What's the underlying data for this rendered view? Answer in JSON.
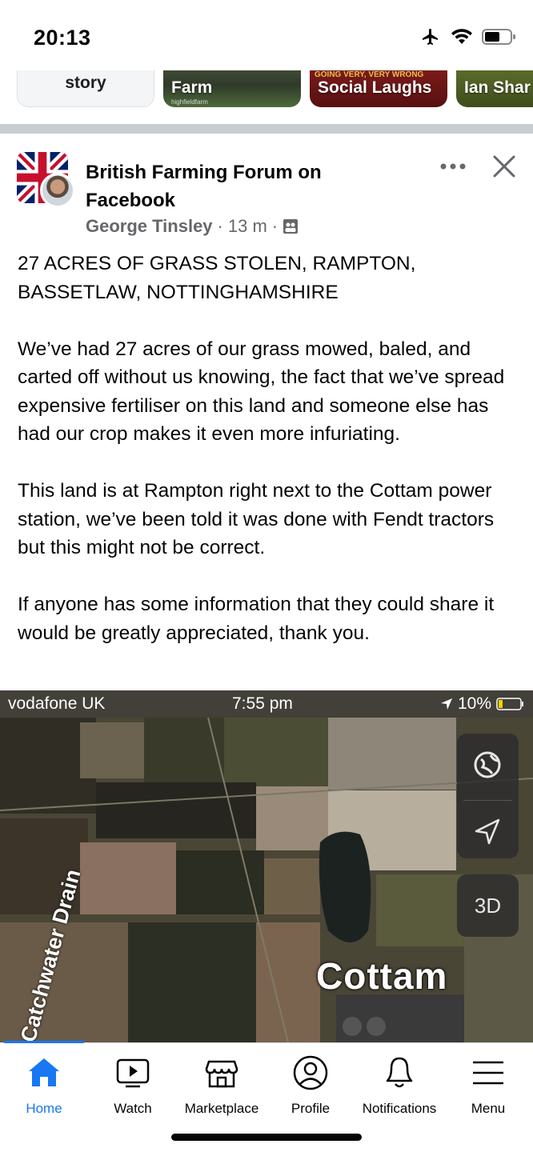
{
  "status_bar": {
    "time": "20:13",
    "icons": [
      "airplane-icon",
      "wifi-icon",
      "battery-icon"
    ]
  },
  "stories": [
    {
      "label": "story",
      "type": "create"
    },
    {
      "label": "Farm",
      "handle": "highfieldfarm"
    },
    {
      "label": "Social Laughs",
      "overlay": "GOING VERY, VERY WRONG"
    },
    {
      "label": "Ian Shar"
    }
  ],
  "post": {
    "group_name": "British Farming Forum on Facebook",
    "author": "George Tinsley",
    "time": "13 m",
    "separator": "·",
    "paragraphs": [
      "27 ACRES OF GRASS STOLEN, RAMPTON, BASSETLAW, NOTTINGHAMSHIRE",
      "We’ve had 27 acres of our grass mowed, baled, and carted off without us knowing, the fact that we’ve spread expensive fertiliser on this land and someone else has had our crop makes it even more infuriating.",
      "This land is at Rampton right next to the Cottam power station, we’ve been told it was done with Fendt tractors but this might not be correct.",
      "If anyone has some information that they could share it would be greatly appreciated, thank you."
    ]
  },
  "map_image": {
    "carrier": "vodafone UK",
    "time": "7:55 pm",
    "battery": "10%",
    "label_drain": "Catchwater Drain",
    "label_place": "Cottam",
    "button_3d": "3D"
  },
  "bottom_nav": {
    "items": [
      {
        "label": "Home",
        "icon": "home-icon",
        "active": true
      },
      {
        "label": "Watch",
        "icon": "watch-icon",
        "active": false
      },
      {
        "label": "Marketplace",
        "icon": "marketplace-icon",
        "active": false
      },
      {
        "label": "Profile",
        "icon": "profile-icon",
        "active": false
      },
      {
        "label": "Notifications",
        "icon": "bell-icon",
        "active": false
      },
      {
        "label": "Menu",
        "icon": "menu-icon",
        "active": false
      }
    ]
  },
  "colors": {
    "accent": "#1877f2",
    "text": "#050505",
    "secondary_text": "#65676b",
    "divider": "#c9ccd1"
  }
}
